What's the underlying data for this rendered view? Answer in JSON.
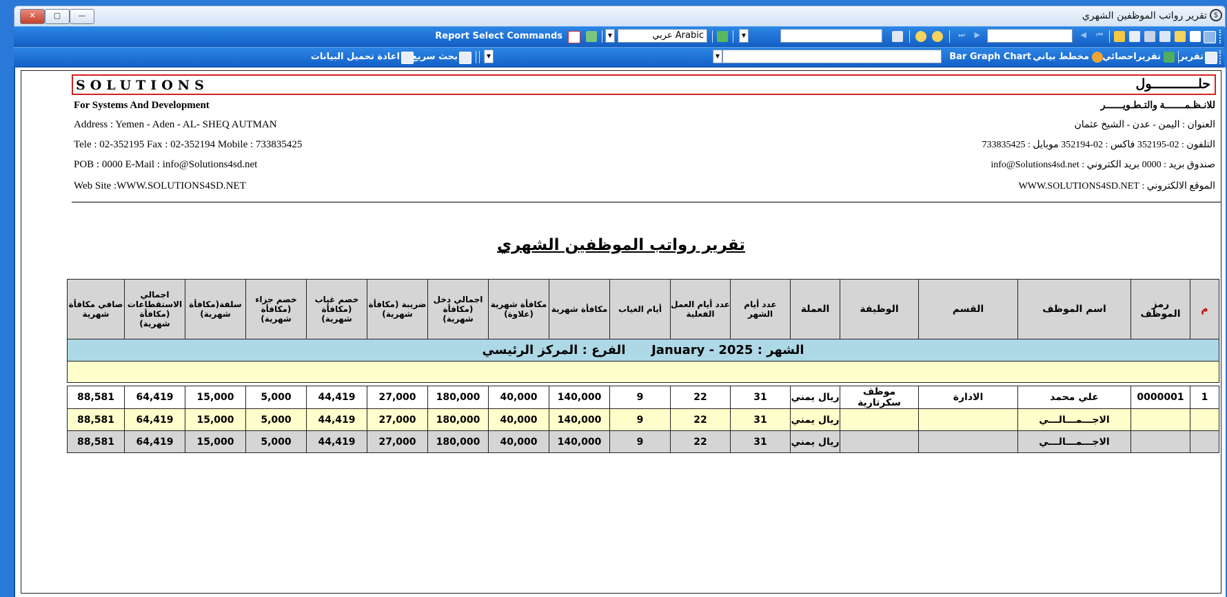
{
  "window": {
    "title": "تقرير رواتب الموظفين الشهري",
    "buttons": {
      "close": "✕",
      "restore": "▢",
      "minimize": "—"
    }
  },
  "toolbar1": {
    "report_select_commands": "Report Select Commands",
    "language_en": "Arabic",
    "language_ar": "عربي"
  },
  "toolbar2": {
    "report": "تقرير",
    "statistical_report": "تقريراحصائي",
    "chart": "مخطط بياني",
    "chart_type": "Bar Graph Chart",
    "quick_search": "بحث سريع",
    "reload_data": "اعادة تحميل البيانات"
  },
  "company": {
    "name_en": "SOLUTIONS",
    "name_ar": "حلــــــــــــول",
    "sub_en": "For Systems And Development",
    "sub_ar": "للانـظـمـــــــة والتـطـويــــــر",
    "address_en": "Address : Yemen - Aden  - AL- SHEQ AUTMAN",
    "address_ar": "العنوان : اليمن - عدن - الشيخ عثمان",
    "phone_en": "Tele : 02-352195  Fax : 02-352194  Mobile : 733835425",
    "phone_ar": "التلفون : 02-352195  فاكس : 02-352194  موبايل : 733835425",
    "pob_en": "POB : 0000  E-Mail : info@Solutions4sd.net",
    "pob_ar": "صندوق بريد : 0000  بريد الكتروني : info@Solutions4sd.net",
    "web_en": "Web Site :WWW.SOLUTIONS4SD.NET",
    "web_ar": "الموقع الالكتروني : WWW.SOLUTIONS4SD.NET"
  },
  "report": {
    "title": "تقرير رواتب الموظفين الشهري",
    "columns": [
      "م",
      "رمز الموظف",
      "اسم الموظف",
      "القسم",
      "الوظيفة",
      "العملة",
      "عدد أيام الشهر",
      "عدد أيام العمل الفعلية",
      "أيام الغياب",
      "مكافأة شهرية",
      "مكافأة شهرية (علاوة)",
      "اجمالي دخل (مكافأة شهرية)",
      "ضريبة (مكافأة شهرية)",
      "خصم غياب (مكافأة شهرية)",
      "خصم جزاء (مكافأة شهرية)",
      "سلفة(مكافأة شهرية)",
      "اجمالي الاستقطاعات (مكافأة شهرية)",
      "صافي مكافأة شهرية"
    ],
    "group": {
      "month_label": "الشهر :",
      "month_value": "January - 2025",
      "branch_label": "الفرع :",
      "branch_value": "المركز الرئيسي"
    },
    "rows": [
      [
        "1",
        "0000001",
        "علي محمد",
        "الادارة",
        "موظف سكرتارية",
        "ريال يمني",
        "31",
        "22",
        "9",
        "140,000",
        "40,000",
        "180,000",
        "27,000",
        "44,419",
        "5,000",
        "15,000",
        "64,419",
        "88,581"
      ]
    ],
    "totals": [
      [
        "",
        "",
        "الاجـــمـــالـــي",
        "",
        "",
        "ريال يمني",
        "31",
        "22",
        "9",
        "140,000",
        "40,000",
        "180,000",
        "27,000",
        "44,419",
        "5,000",
        "15,000",
        "64,419",
        "88,581"
      ],
      [
        "",
        "",
        "الاجـــمـــالـــي",
        "",
        "",
        "ريال يمني",
        "31",
        "22",
        "9",
        "140,000",
        "40,000",
        "180,000",
        "27,000",
        "44,419",
        "5,000",
        "15,000",
        "64,419",
        "88,581"
      ]
    ]
  },
  "colors": {
    "toolbar": "#1460c6",
    "header_border": "#d42020",
    "group_bar": "#add8e6",
    "total_yellow": "#ffffcc",
    "total_gray": "#d5d5d5"
  }
}
